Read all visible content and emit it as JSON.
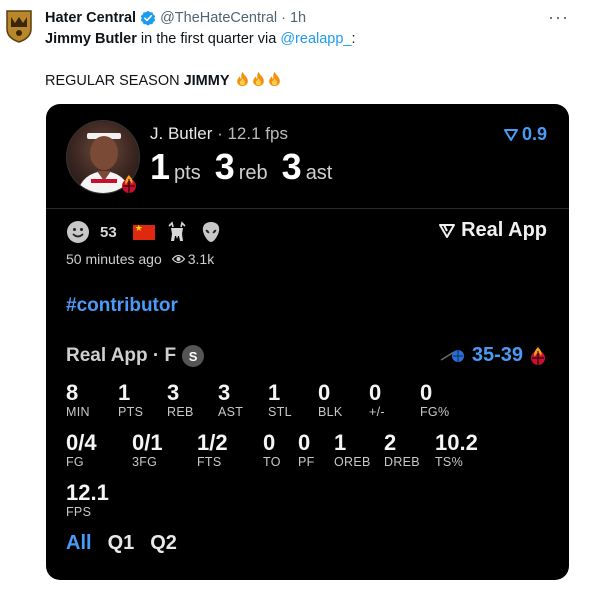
{
  "tweet": {
    "author_name": "Hater Central",
    "handle": "@TheHateCentral",
    "separator": "·",
    "time": "1h",
    "more": "···",
    "line1_bold": "Jimmy Butler",
    "line1_mid": " in the first quarter via ",
    "line1_mention": "@realapp_",
    "line1_end": ":",
    "line2_plain": "REGULAR SEASON ",
    "line2_bold": "JIMMY"
  },
  "card": {
    "player": "J. Butler",
    "fps_text": " · 12.1 fps",
    "rating": "0.9",
    "big_stats": [
      {
        "value": "1",
        "label": "pts"
      },
      {
        "value": "3",
        "label": "reb"
      },
      {
        "value": "3",
        "label": "ast"
      }
    ],
    "reaction_count": "53",
    "brand": "Real App",
    "posted": "50 minutes ago",
    "views": "3.1k",
    "hashtag": "#contributor",
    "section_title": "Real App · F",
    "section_badge": "S",
    "score": "35-39",
    "stats_row1": [
      {
        "value": "8",
        "label": "MIN"
      },
      {
        "value": "1",
        "label": "PTS"
      },
      {
        "value": "3",
        "label": "REB"
      },
      {
        "value": "3",
        "label": "AST"
      },
      {
        "value": "1",
        "label": "STL"
      },
      {
        "value": "0",
        "label": "BLK"
      },
      {
        "value": "0",
        "label": "+/-"
      },
      {
        "value": "0",
        "label": "FG%"
      }
    ],
    "stats_row2": [
      {
        "value": "0/4",
        "label": "FG"
      },
      {
        "value": "0/1",
        "label": "3FG"
      },
      {
        "value": "1/2",
        "label": "FTS"
      },
      {
        "value": "0",
        "label": "TO"
      },
      {
        "value": "0",
        "label": "PF"
      },
      {
        "value": "1",
        "label": "OREB"
      },
      {
        "value": "2",
        "label": "DREB"
      },
      {
        "value": "10.2",
        "label": "TS%"
      }
    ],
    "stats_row3": [
      {
        "value": "12.1",
        "label": "FPS"
      }
    ],
    "tabs": [
      "All",
      "Q1",
      "Q2"
    ]
  },
  "colors": {
    "accent_blue": "#4a9bf5",
    "link_blue": "#1d9bf0",
    "card_bg": "#000000"
  }
}
